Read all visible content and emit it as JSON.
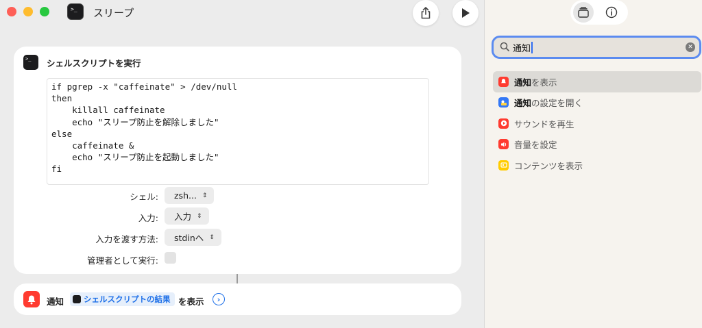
{
  "window": {
    "title": "スリープ"
  },
  "action_script": {
    "title": "シェルスクリプトを実行",
    "code": "if pgrep -x \"caffeinate\" > /dev/null\nthen\n    killall caffeinate\n    echo \"スリープ防止を解除しました\"\nelse\n    caffeinate &\n    echo \"スリープ防止を起動しました\"\nfi",
    "params": {
      "shell_label": "シェル:",
      "shell_value": "zsh...",
      "input_label": "入力:",
      "input_value": "入力",
      "pass_label": "入力を渡す方法:",
      "pass_value": "stdinへ",
      "admin_label": "管理者として実行:"
    }
  },
  "action_notify": {
    "verb": "通知",
    "variable": "シェルスクリプトの結果",
    "suffix": "を表示"
  },
  "sidebar": {
    "search_value": "通知",
    "results": [
      {
        "match": "通知",
        "rest": "を表示",
        "icon": "notification-icon",
        "color": "#ff3b30"
      },
      {
        "match": "通知",
        "rest": "の設定を開く",
        "icon": "settings-app-icon",
        "color": "#3478f6"
      },
      {
        "match": "",
        "rest": "サウンドを再生",
        "icon": "play-sound-icon",
        "color": "#ff3b30"
      },
      {
        "match": "",
        "rest": "音量を設定",
        "icon": "volume-icon",
        "color": "#ff3b30"
      },
      {
        "match": "",
        "rest": "コンテンツを表示",
        "icon": "content-icon",
        "color": "#ffcc00"
      }
    ]
  }
}
